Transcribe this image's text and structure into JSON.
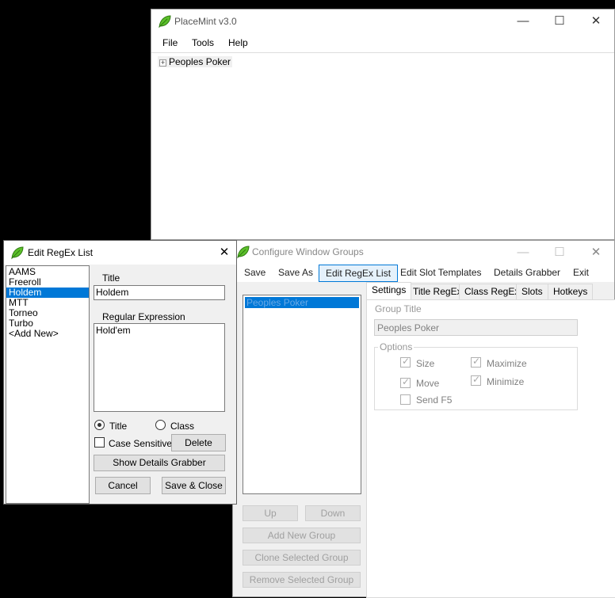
{
  "main_window": {
    "title": "PlaceMint v3.0",
    "controls": {
      "minimize": "—",
      "maximize": "☐",
      "close": "✕"
    },
    "menu": [
      "File",
      "Tools",
      "Help"
    ],
    "tree": {
      "expander": "+",
      "node": "Peoples Poker"
    }
  },
  "configure_window": {
    "title": "Configure Window Groups",
    "controls": {
      "minimize": "—",
      "maximize": "☐",
      "close": "✕"
    },
    "menu": [
      "Save",
      "Save As",
      "Edit RegEx List",
      "Edit Slot Templates",
      "Details Grabber",
      "Exit"
    ],
    "active_menu": "Edit RegEx List",
    "groups": [
      "Peoples Poker"
    ],
    "buttons": {
      "up": "Up",
      "down": "Down",
      "add": "Add New Group",
      "clone": "Clone Selected Group",
      "remove": "Remove Selected Group"
    },
    "tabs": [
      "Settings",
      "Title RegEx",
      "Class RegEx",
      "Slots",
      "Hotkeys"
    ],
    "settings": {
      "group_title_label": "Group Title",
      "group_title_value": "Peoples Poker",
      "options_label": "Options",
      "options": [
        {
          "label": "Size",
          "checked": true
        },
        {
          "label": "Maximize",
          "checked": true
        },
        {
          "label": "Move",
          "checked": true
        },
        {
          "label": "Minimize",
          "checked": true
        },
        {
          "label": "Send F5",
          "checked": false
        }
      ]
    }
  },
  "edit_dialog": {
    "title": "Edit RegEx List",
    "close": "✕",
    "list": [
      "AAMS",
      "Freeroll",
      "Holdem",
      "MTT",
      "Torneo",
      "Turbo",
      "<Add New>"
    ],
    "selected": "Holdem",
    "title_label": "Title",
    "title_value": "Holdem",
    "regex_label": "Regular Expression",
    "regex_value": "Hold'em",
    "radio_title": "Title",
    "radio_class": "Class",
    "case_sensitive": "Case Sensitive",
    "delete": "Delete",
    "show_details": "Show Details Grabber",
    "cancel": "Cancel",
    "save_close": "Save & Close"
  },
  "colors": {
    "accent": "#0078d7",
    "leaf": "#3a9a1a"
  }
}
